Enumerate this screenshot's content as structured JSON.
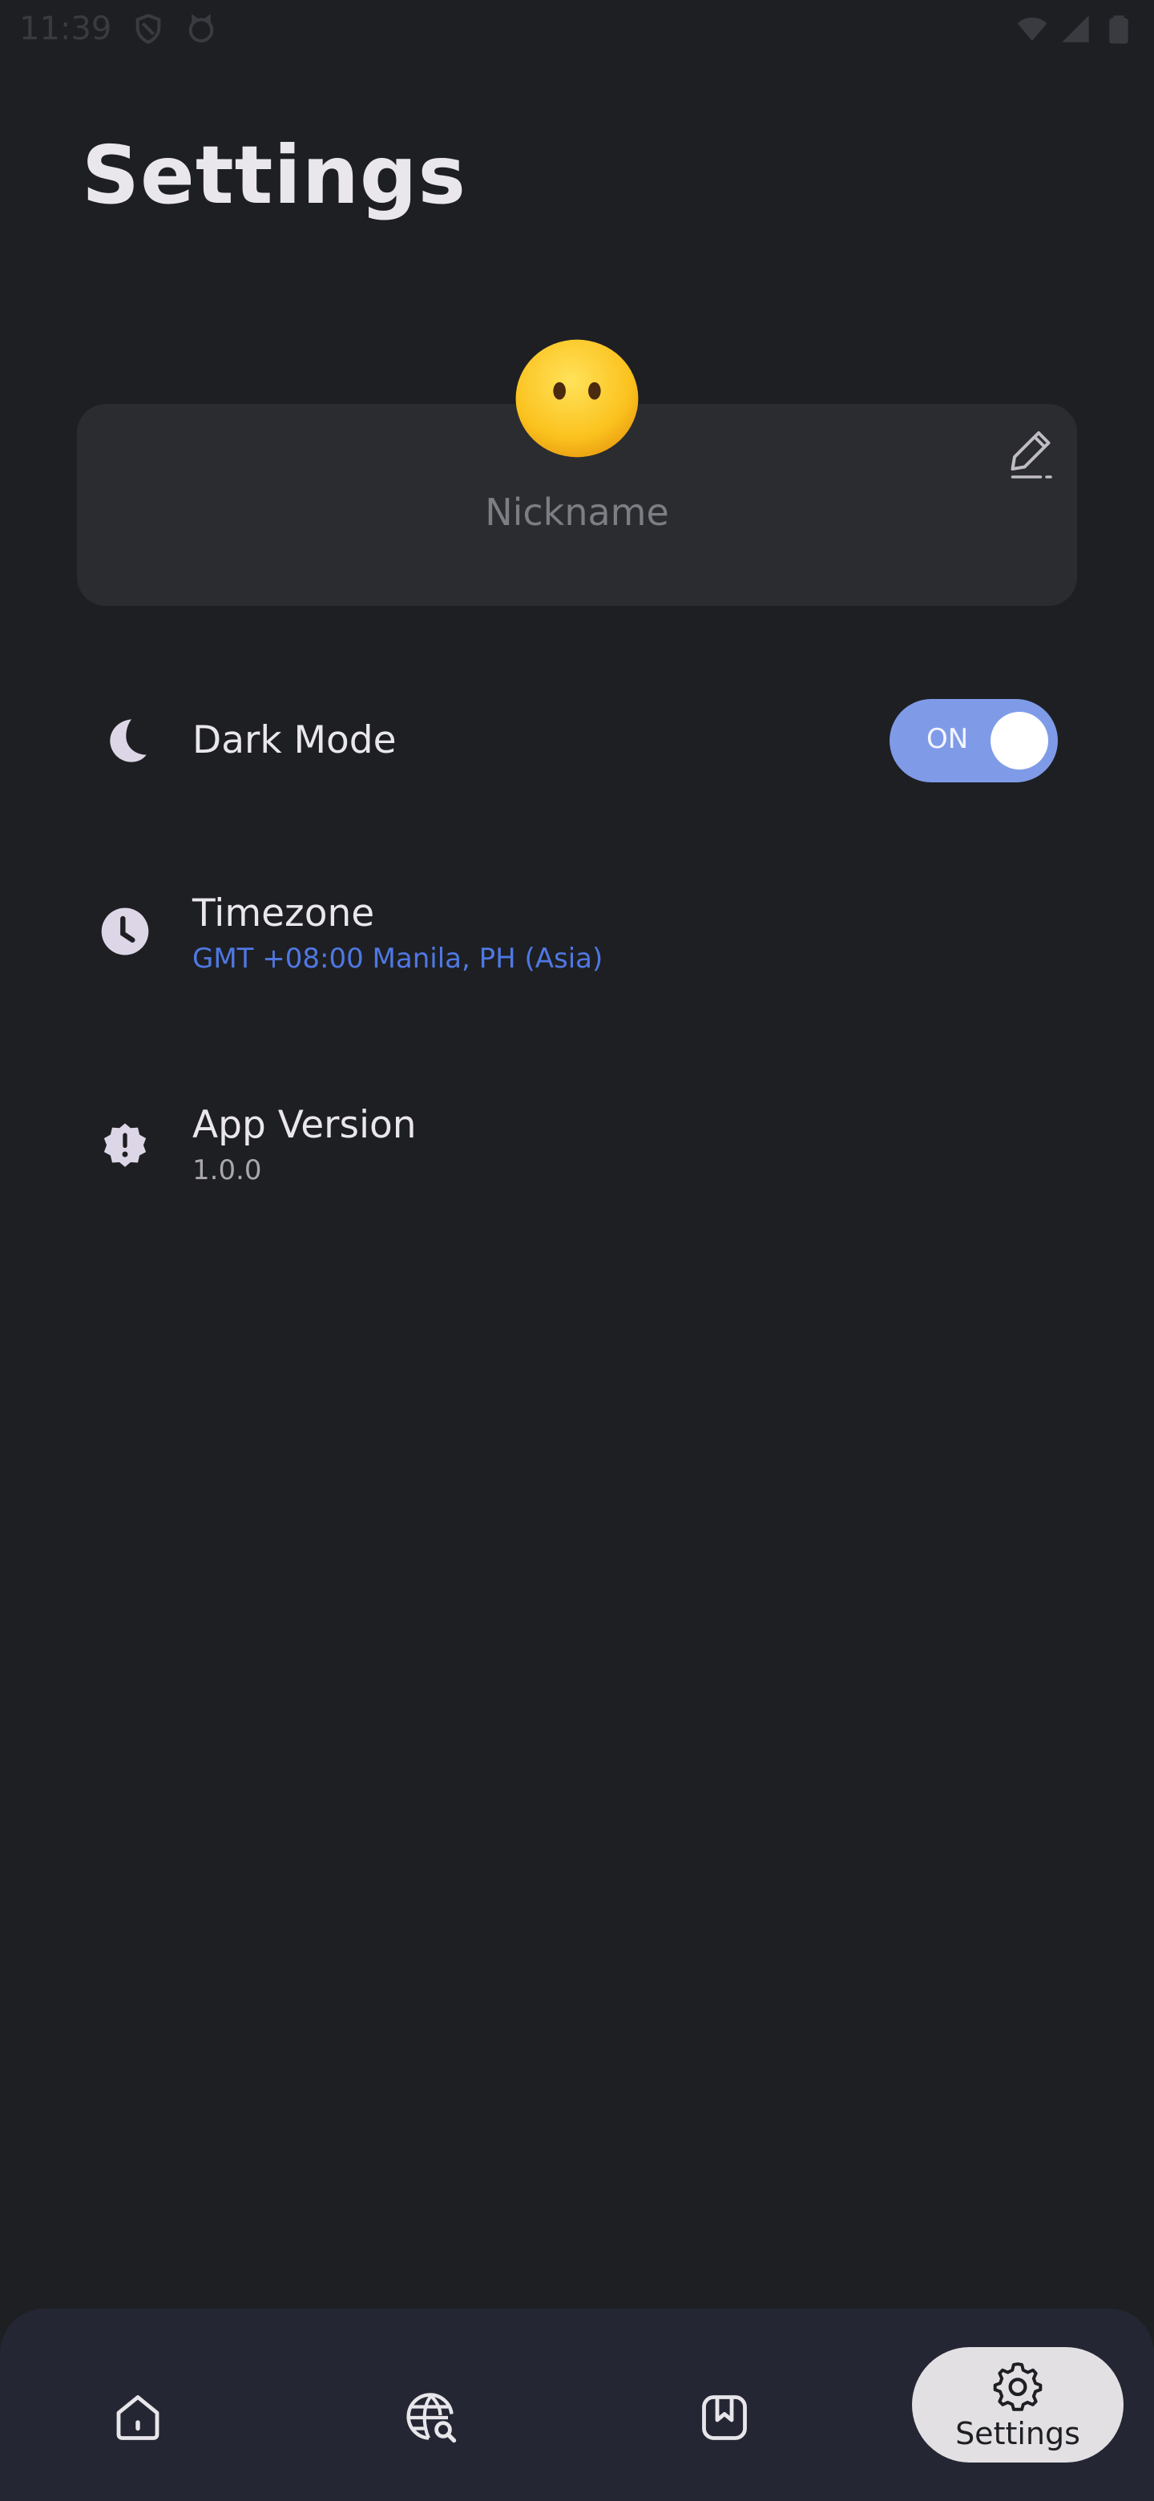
{
  "status_bar": {
    "time": "11:39",
    "left_icons": [
      "shield-icon",
      "cat-face-icon"
    ],
    "right_icons": [
      "wifi-icon",
      "signal-icon",
      "battery-icon"
    ]
  },
  "header": {
    "title": "Settings"
  },
  "profile": {
    "avatar_icon": "face-without-mouth-emoji",
    "nickname_placeholder": "Nickname",
    "edit_icon": "pencil-icon"
  },
  "settings": {
    "dark_mode": {
      "label": "Dark Mode",
      "icon": "moon-icon",
      "toggle_text": "ON",
      "enabled": true
    },
    "timezone": {
      "label": "Timezone",
      "icon": "clock-icon",
      "value": "GMT +08:00 Manila, PH (Asia)"
    },
    "app_version": {
      "label": "App Version",
      "icon": "alert-badge-icon",
      "value": "1.0.0"
    }
  },
  "bottom_nav": {
    "items": [
      {
        "icon": "home-icon"
      },
      {
        "icon": "globe-search-icon"
      },
      {
        "icon": "bookmark-icon"
      },
      {
        "icon": "gear-icon",
        "label": "Settings",
        "active": true
      }
    ]
  },
  "colors": {
    "background": "#1e1f23",
    "card": "#2a2c30",
    "accent": "#7f9be8",
    "link_text": "#4f78e3",
    "nav_bg": "#242733"
  }
}
